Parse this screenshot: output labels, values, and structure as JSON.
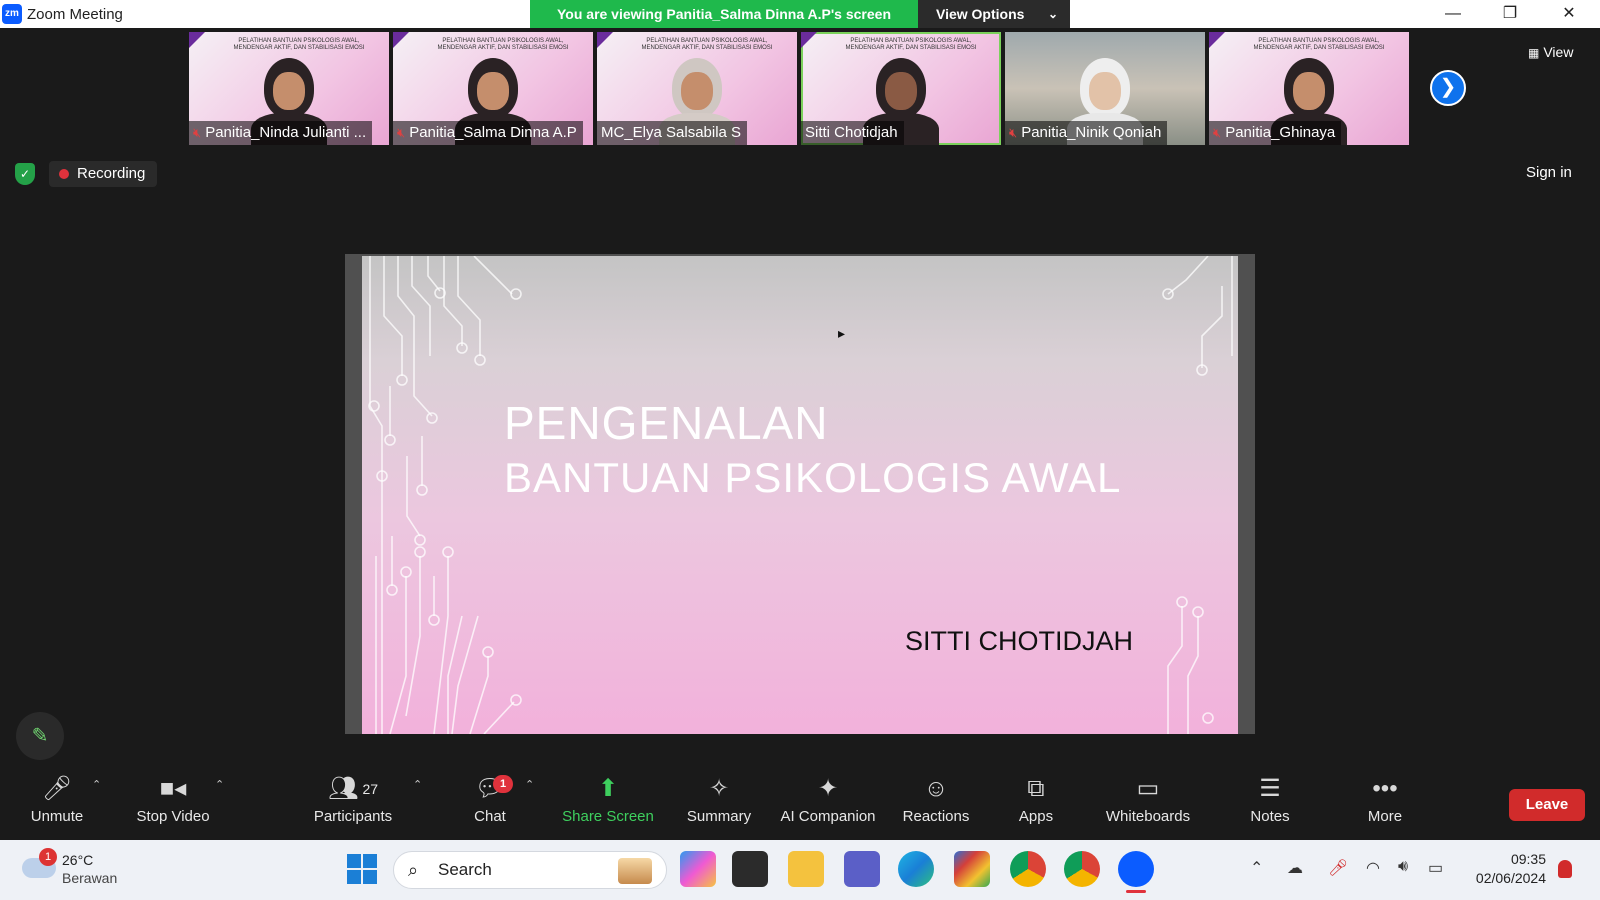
{
  "window": {
    "app_logo": "zm",
    "title": "Zoom Meeting",
    "share_banner": "You are viewing Panitia_Salma Dinna A.P's screen",
    "view_options": "View Options",
    "minimize": "—",
    "restore": "❐",
    "close": "✕"
  },
  "thumbnails": [
    {
      "name": "Panitia_Ninda Julianti ...",
      "muted": true,
      "type": "slide"
    },
    {
      "name": "Panitia_Salma Dinna A.P",
      "muted": true,
      "type": "slide"
    },
    {
      "name": "MC_Elya Salsabila S",
      "muted": false,
      "type": "slide"
    },
    {
      "name": "Sitti Chotidjah",
      "muted": false,
      "type": "slide",
      "active": true
    },
    {
      "name": "Panitia_Ninik Qoniah",
      "muted": true,
      "type": "camera"
    },
    {
      "name": "Panitia_Ghinaya",
      "muted": true,
      "type": "slide"
    }
  ],
  "thumb_slide_text": "PELATIHAN\nBANTUAN PSIKOLOGIS AWAL, MENDENGAR AKTIF, DAN STABILISASI EMOSI",
  "view_button": "View",
  "status": {
    "recording": "Recording",
    "sign_in": "Sign in"
  },
  "slide": {
    "title_line1": "PENGENALAN",
    "title_line2": "BANTUAN PSIKOLOGIS AWAL",
    "author": "SITTI CHOTIDJAH"
  },
  "toolbar": {
    "unmute": "Unmute",
    "stop_video": "Stop Video",
    "participants": "Participants",
    "participants_count": "27",
    "chat": "Chat",
    "chat_badge": "1",
    "share_screen": "Share Screen",
    "summary": "Summary",
    "ai_companion": "AI Companion",
    "reactions": "Reactions",
    "apps": "Apps",
    "whiteboards": "Whiteboards",
    "notes": "Notes",
    "more": "More",
    "leave": "Leave"
  },
  "taskbar": {
    "weather_badge": "1",
    "temperature": "26°C",
    "condition": "Berawan",
    "search_placeholder": "Search",
    "time": "09:35",
    "date": "02/06/2024"
  },
  "colors": {
    "share_green": "#1fb94c",
    "leave_red": "#d12b2b",
    "accent_blue": "#0e72ed"
  }
}
